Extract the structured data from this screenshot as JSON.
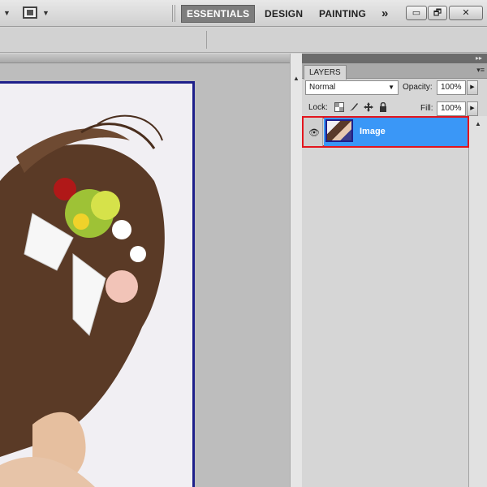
{
  "app_bar": {
    "workspaces": [
      {
        "label": "ESSENTIALS",
        "active": true
      },
      {
        "label": "DESIGN",
        "active": false
      },
      {
        "label": "PAINTING",
        "active": false
      }
    ],
    "more_label": "»",
    "arrow_glyph": "▼",
    "window_buttons": {
      "minimize": "▭",
      "restore": "🗗",
      "close": "✕"
    }
  },
  "layers_panel": {
    "tab_label": "LAYERS",
    "collapse_glyph": "▸▸",
    "menu_glyph": "▾≡",
    "blend_mode": "Normal",
    "opacity_label": "Opacity:",
    "opacity_value": "100%",
    "lock_label": "Lock:",
    "fill_label": "Fill:",
    "fill_value": "100%",
    "layers": [
      {
        "name": "Image",
        "visible": true,
        "selected": true
      }
    ]
  },
  "colors": {
    "selection": "#3a97f7",
    "highlight_outline": "#e3151d",
    "canvas_border": "#1e1f8a"
  }
}
